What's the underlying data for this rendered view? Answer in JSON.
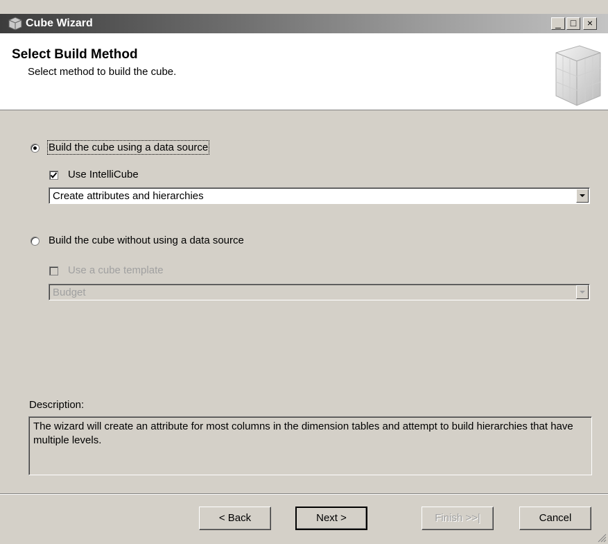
{
  "window": {
    "title": "Cube Wizard",
    "controls": {
      "minimize": "_",
      "maximize": "□",
      "close": "×"
    }
  },
  "header": {
    "title": "Select Build Method",
    "subtitle": "Select method to build the cube.",
    "graphic": "cube-graphic"
  },
  "options": {
    "with_source": {
      "label": "Build the cube using a data source",
      "selected": true,
      "intellicube": {
        "label": "Use IntelliCube",
        "checked": true
      },
      "combo_value": "Create attributes and hierarchies"
    },
    "without_source": {
      "label": "Build the cube without using a data source",
      "selected": false,
      "template": {
        "label": "Use a cube template",
        "checked": false
      },
      "combo_value": "Budget"
    }
  },
  "description": {
    "label": "Description:",
    "text": "The wizard will create an attribute for most columns in the dimension tables and attempt to build hierarchies that have multiple levels."
  },
  "buttons": {
    "back": "< Back",
    "next": "Next >",
    "finish": "Finish >>|",
    "cancel": "Cancel"
  }
}
